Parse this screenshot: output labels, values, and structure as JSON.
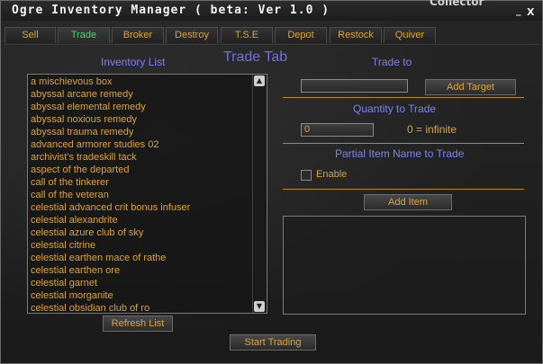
{
  "window": {
    "title": "Ogre Inventory Manager ( beta: Ver 1.0 )",
    "background_title": "Collector",
    "minimize_label": "_",
    "close_label": "X"
  },
  "tabs": [
    {
      "label": "Sell"
    },
    {
      "label": "Trade"
    },
    {
      "label": "Broker"
    },
    {
      "label": "Destroy"
    },
    {
      "label": "T.S.E"
    },
    {
      "label": "Depot"
    },
    {
      "label": "Restock"
    },
    {
      "label": "Quiver"
    }
  ],
  "active_tab": "Trade",
  "inventory": {
    "heading": "Inventory List",
    "items": [
      "a mischievous box",
      "abyssal arcane remedy",
      "abyssal elemental remedy",
      "abyssal noxious remedy",
      "abyssal trauma remedy",
      "advanced armorer studies 02",
      "archivist's tradeskill tack",
      "aspect of the departed",
      "call of the tinkerer",
      "call of the veteran",
      "celestial advanced crit bonus infuser",
      "celestial alexandrite",
      "celestial azure club of sky",
      "celestial citrine",
      "celestial earthen mace of rathe",
      "celestial earthen ore",
      "celestial garnet",
      "celestial morganite",
      "celestial obsidian club of ro"
    ],
    "scroll_up_icon": "arrow-up-icon",
    "scroll_down_icon": "arrow-down-icon",
    "refresh_label": "Refresh List"
  },
  "trade_tab_title": "Trade Tab",
  "trade_to": {
    "heading": "Trade to",
    "target_value": "",
    "add_target_label": "Add Target"
  },
  "quantity": {
    "heading": "Quantity to Trade",
    "value": "0",
    "hint": "0 = infinite"
  },
  "partial": {
    "heading": "Partial Item Name to Trade",
    "enable_label": "Enable",
    "enabled": false
  },
  "add_item_label": "Add Item",
  "start_trading_label": "Start Trading",
  "colors": {
    "accent_gold": "#d9a53a",
    "heading_blue": "#7c82f2",
    "active_tab_green": "#4fd26b"
  }
}
